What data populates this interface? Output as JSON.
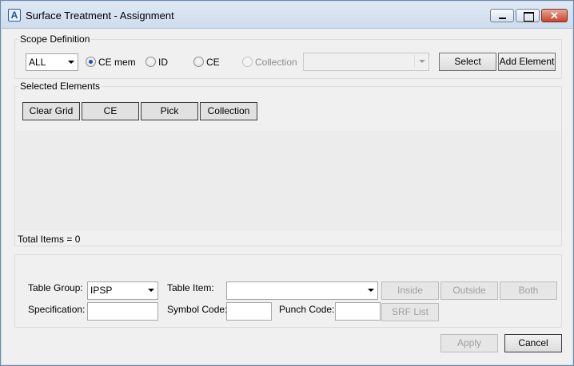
{
  "window": {
    "title": "Surface Treatment - Assignment",
    "app_icon_glyph": "A",
    "controls": {
      "minimize": "minimize-icon",
      "maximize": "maximize-icon",
      "close_glyph": "✕"
    }
  },
  "scope": {
    "legend": "Scope Definition",
    "dropdown_value": "ALL",
    "radios": [
      {
        "label": "CE mem",
        "checked": true,
        "disabled": false
      },
      {
        "label": "ID",
        "checked": false,
        "disabled": false
      },
      {
        "label": "CE",
        "checked": false,
        "disabled": false
      },
      {
        "label": "Collection",
        "checked": false,
        "disabled": true
      }
    ],
    "collection_combo_value": "",
    "select_label": "Select",
    "add_element_label": "Add Element"
  },
  "selected": {
    "legend": "Selected Elements",
    "buttons": [
      "Clear Grid",
      "CE",
      "Pick",
      "Collection"
    ],
    "total_items": "Total Items = 0"
  },
  "assignment": {
    "table_group_label": "Table Group:",
    "table_group_value": "IPSP",
    "table_item_label": "Table Item:",
    "table_item_value": "",
    "inside_label": "Inside",
    "outside_label": "Outside",
    "both_label": "Both",
    "specification_label": "Specification:",
    "specification_value": "",
    "symbol_code_label": "Symbol Code:",
    "symbol_code_value": "",
    "punch_code_label": "Punch Code:",
    "punch_code_value": "",
    "srf_list_label": "SRF List"
  },
  "footer": {
    "apply_label": "Apply",
    "cancel_label": "Cancel"
  },
  "colors": {
    "titlebar": "#dfe9f5",
    "radio_selected": "#1b4fae",
    "close_button": "#c7452f",
    "disabled_text": "#a0a0a0"
  }
}
